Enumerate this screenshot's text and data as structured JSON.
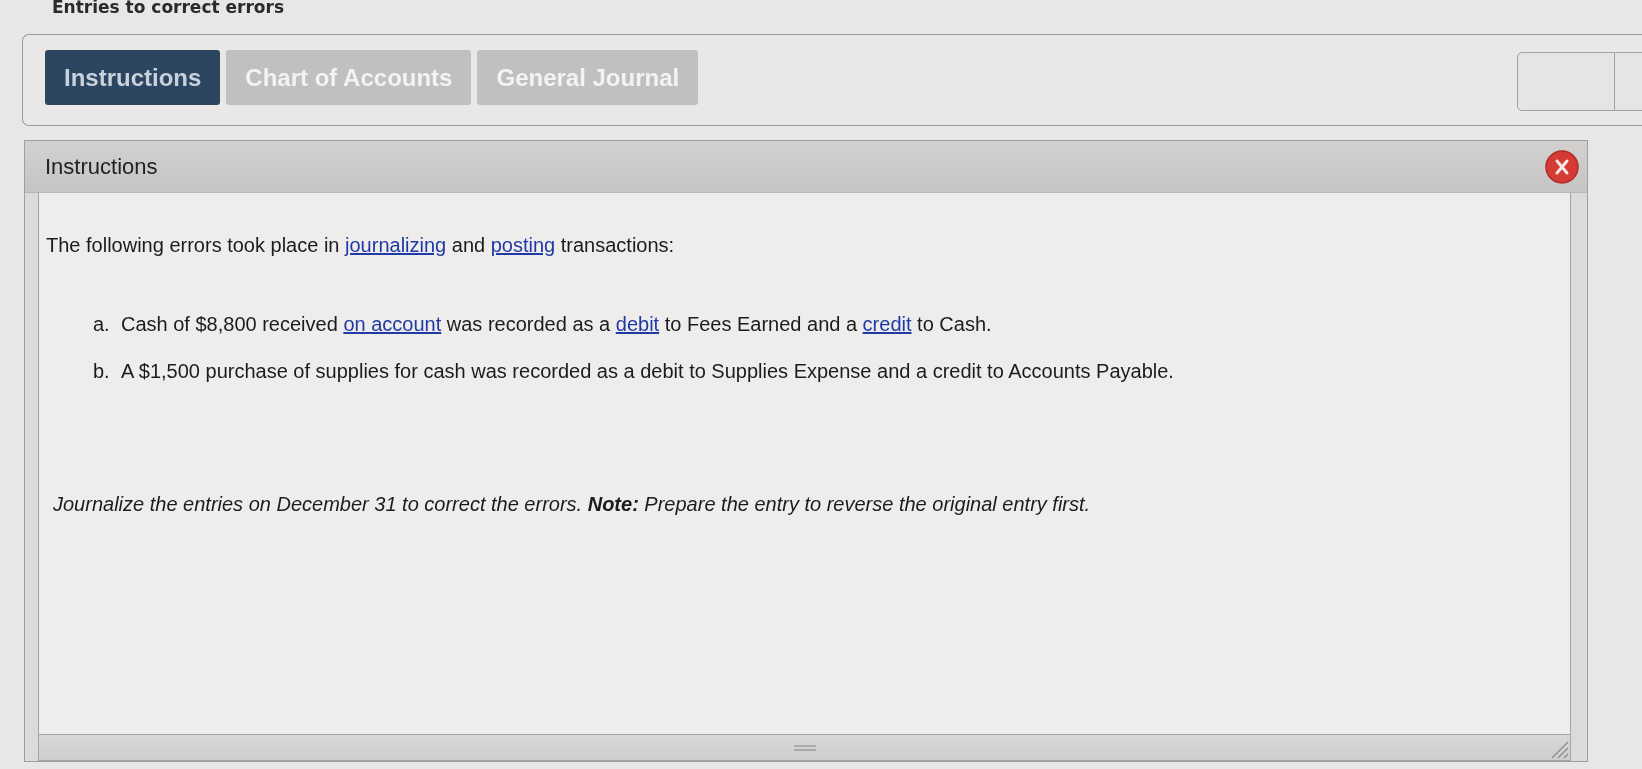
{
  "title": "Entries to correct errors",
  "tabs": [
    {
      "label": "Instructions",
      "selected": true
    },
    {
      "label": "Chart of Accounts",
      "selected": false
    },
    {
      "label": "General Journal",
      "selected": false
    }
  ],
  "panel": {
    "title": "Instructions",
    "intro": [
      {
        "kind": "text",
        "text": "The following errors took place in "
      },
      {
        "kind": "link",
        "text": "journalizing"
      },
      {
        "kind": "text",
        "text": " and "
      },
      {
        "kind": "link",
        "text": "posting"
      },
      {
        "kind": "text",
        "text": " transactions:"
      }
    ],
    "errors": [
      {
        "marker": "a.",
        "segments": [
          {
            "kind": "text",
            "text": "Cash of $8,800 received "
          },
          {
            "kind": "link",
            "text": "on account"
          },
          {
            "kind": "text",
            "text": " was recorded as a "
          },
          {
            "kind": "link",
            "text": "debit"
          },
          {
            "kind": "text",
            "text": " to Fees Earned and a "
          },
          {
            "kind": "link",
            "text": "credit"
          },
          {
            "kind": "text",
            "text": " to Cash."
          }
        ]
      },
      {
        "marker": "b.",
        "segments": [
          {
            "kind": "text",
            "text": "A $1,500 purchase of supplies for cash was recorded as a debit to Supplies Expense and a credit to Accounts Payable."
          }
        ]
      }
    ],
    "task": "Journalize the entries on December 31 to correct the errors. **Note:** Prepare the entry to reverse the original entry first."
  }
}
